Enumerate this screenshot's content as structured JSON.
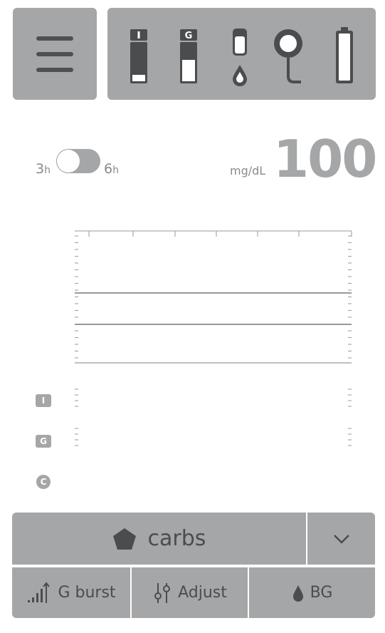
{
  "header": {
    "menu_icon": "hamburger-menu-icon",
    "status_icons": [
      {
        "name": "insulin-cartridge-icon",
        "letter": "I"
      },
      {
        "name": "glucagon-cartridge-icon",
        "letter": "G"
      },
      {
        "name": "infusion-set-icon"
      },
      {
        "name": "cgm-sensor-icon"
      },
      {
        "name": "battery-icon"
      }
    ]
  },
  "toggle": {
    "left_num": "3",
    "left_unit": "h",
    "right_num": "6",
    "right_unit": "h"
  },
  "glucose": {
    "unit": "mg/dL",
    "value": "100"
  },
  "side_labels": {
    "insulin": "I",
    "glucagon": "G",
    "carbs": "C"
  },
  "actions": {
    "carbs_label": "carbs",
    "carbs_icon": "pentagon-icon",
    "dropdown_icon": "chevron-down-icon",
    "gburst_label": "G burst",
    "adjust_label": "Adjust",
    "bg_label": "BG"
  },
  "colors": {
    "panel": "#a5a6a8",
    "icon_dark": "#4b4c4d",
    "text_gray": "#8a8a8a",
    "background": "#ffffff"
  }
}
